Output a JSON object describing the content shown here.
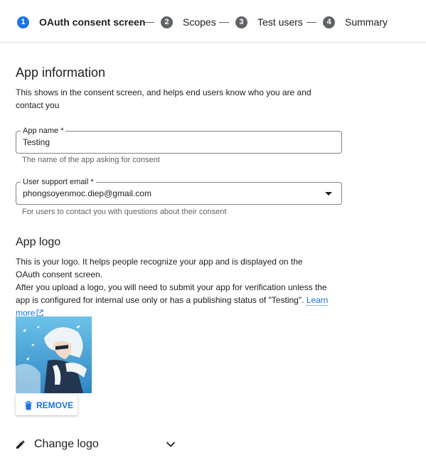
{
  "stepper": {
    "steps": [
      {
        "number": "1",
        "label": "OAuth consent screen"
      },
      {
        "number": "2",
        "label": "Scopes"
      },
      {
        "number": "3",
        "label": "Test users"
      },
      {
        "number": "4",
        "label": "Summary"
      }
    ],
    "active_step": 1
  },
  "app_info": {
    "heading": "App information",
    "description": "This shows in the consent screen, and helps end users know who you are and contact you"
  },
  "app_name": {
    "label": "App name *",
    "value": "Testing",
    "hint": "The name of the app asking for consent"
  },
  "support_email": {
    "label": "User support email *",
    "value": "phongsoyenmoc.diep@gmail.com",
    "hint": "For users to contact you with questions about their consent"
  },
  "app_logo": {
    "heading": "App logo",
    "line1": "This is your logo. It helps people recognize your app and is displayed on the OAuth consent screen.",
    "line2": "After you upload a logo, you will need to submit your app for verification unless the app is configured for internal use only or has a publishing status of \"Testing\".",
    "learn_more": "Learn more",
    "remove_label": "REMOVE",
    "change_logo_label": "Change logo"
  },
  "colors": {
    "accent": "#1a73e8",
    "text": "#202124",
    "muted": "#5f6368",
    "border": "#80868b"
  }
}
